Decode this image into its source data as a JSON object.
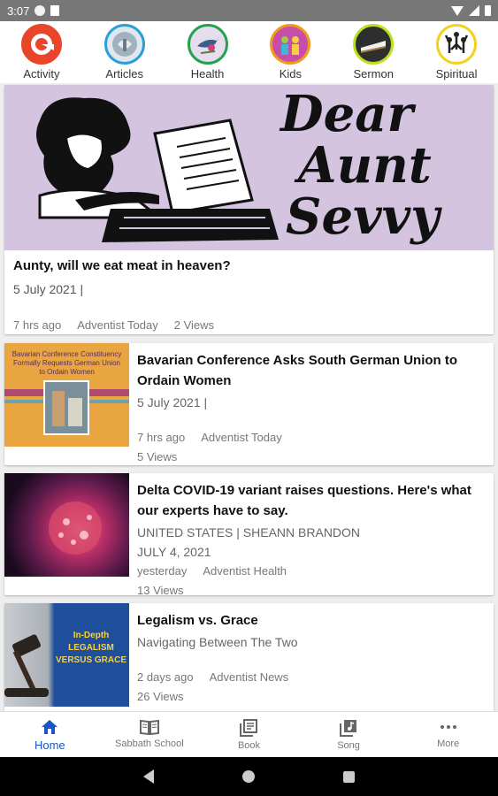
{
  "status_bar": {
    "time": "3:07"
  },
  "categories": [
    {
      "label": "Activity",
      "icon": "activity-icon",
      "ring": "#e8452a"
    },
    {
      "label": "Articles",
      "icon": "articles-icon",
      "ring": "#2a9fd8"
    },
    {
      "label": "Health",
      "icon": "health-icon",
      "ring": "#23a24d"
    },
    {
      "label": "Kids",
      "icon": "kids-icon",
      "ring": "#f29a1c"
    },
    {
      "label": "Sermon",
      "icon": "sermon-icon",
      "ring": "#2e2e2e"
    },
    {
      "label": "Spiritual",
      "icon": "spiritual-icon",
      "ring": "#f2d21c"
    }
  ],
  "hero": {
    "line1": "Dear",
    "line2": "Aunt",
    "line3": "Sevvy"
  },
  "featured": {
    "title": "Aunty, will we eat meat in heaven?",
    "date": "5 July 2021  |",
    "time_ago": "7 hrs ago",
    "source": "Adventist Today",
    "views": "2 Views"
  },
  "articles": [
    {
      "title": "Bavarian Conference Asks South German Union to Ordain Women",
      "subtitle": "5 July 2021  |",
      "subtitle2": "",
      "time_ago": "7 hrs ago",
      "source": "Adventist Today",
      "views": "5 Views",
      "thumb_text": "Bavarian Conference Constituency Formally Requests German Union to Ordain Women"
    },
    {
      "title": "Delta COVID-19 variant raises questions. Here's what our experts have to say.",
      "subtitle": "UNITED STATES | SHEANN BRANDON",
      "subtitle2": " JULY 4, 2021",
      "time_ago": "yesterday",
      "source": "Adventist Health",
      "views": "13 Views",
      "thumb_text": ""
    },
    {
      "title": "Legalism vs. Grace",
      "subtitle": "Navigating Between The Two",
      "subtitle2": "",
      "time_ago": "2 days ago",
      "source": "Adventist News",
      "views": "26 Views",
      "thumb_text": "In-Depth LEGALISM VERSUS GRACE"
    }
  ],
  "bottom_nav": [
    {
      "label": "Home",
      "icon": "home-icon",
      "active": true
    },
    {
      "label": "Sabbath School",
      "icon": "book-open-icon",
      "active": false
    },
    {
      "label": "Book",
      "icon": "library-icon",
      "active": false
    },
    {
      "label": "Song",
      "icon": "music-icon",
      "active": false
    },
    {
      "label": "More",
      "icon": "more-dots-icon",
      "active": false
    }
  ],
  "colors": {
    "accent": "#1a55c8",
    "hero_bg": "#d4c4e0",
    "feed_bg": "#eeeeee"
  }
}
